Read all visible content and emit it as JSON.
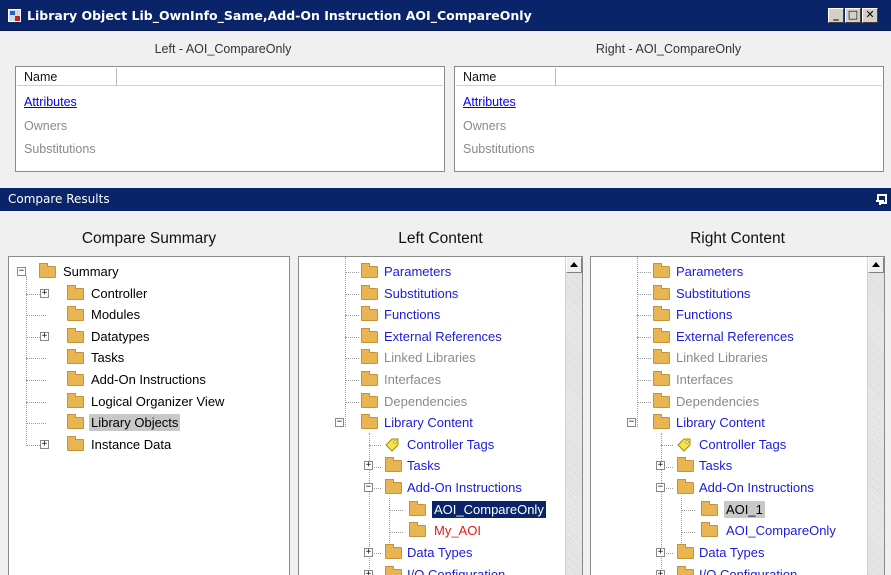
{
  "window": {
    "title": "Library Object Lib_OwnInfo_Same,Add-On Instruction AOI_CompareOnly"
  },
  "top": {
    "left_title": "Left - AOI_CompareOnly",
    "right_title": "Right - AOI_CompareOnly",
    "name_header": "Name",
    "rows": [
      "Attributes",
      "Owners",
      "Substitutions"
    ]
  },
  "compare_results": {
    "title": "Compare Results",
    "columns": [
      "Compare Summary",
      "Left Content",
      "Right Content"
    ]
  },
  "summary_tree": {
    "root": "Summary",
    "items": [
      "Controller",
      "Modules",
      "Datatypes",
      "Tasks",
      "Add-On Instructions",
      "Logical Organizer View",
      "Library Objects",
      "Instance Data"
    ]
  },
  "left_tree": {
    "items": [
      "Parameters",
      "Substitutions",
      "Functions",
      "External References",
      "Linked Libraries",
      "Interfaces",
      "Dependencies",
      "Library Content",
      "Controller Tags",
      "Tasks",
      "Add-On Instructions",
      "AOI_CompareOnly",
      "My_AOI",
      "Data Types",
      "I/O Configuration"
    ]
  },
  "right_tree": {
    "items": [
      "Parameters",
      "Substitutions",
      "Functions",
      "External References",
      "Linked Libraries",
      "Interfaces",
      "Dependencies",
      "Library Content",
      "Controller Tags",
      "Tasks",
      "Add-On Instructions",
      "AOI_1",
      "AOI_CompareOnly",
      "Data Types",
      "I/O Configuration"
    ]
  },
  "colors": {
    "title_bar": "#0a246a",
    "link_blue": "#1a1adf",
    "diff_red": "#e01c1c",
    "disabled_grey": "#8a8a8a",
    "folder": "#e8b552"
  }
}
